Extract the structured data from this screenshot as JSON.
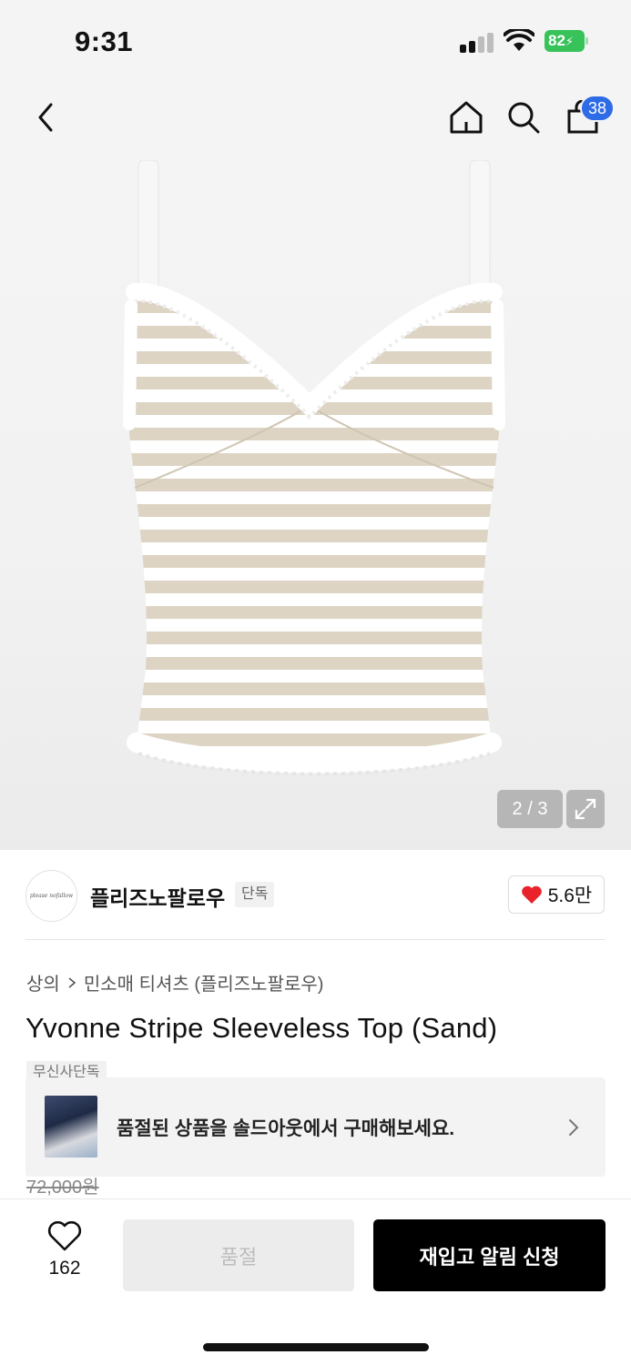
{
  "status_bar": {
    "time": "9:31",
    "battery": "82"
  },
  "nav": {
    "back_icon": "chevron-left-icon",
    "home_icon": "home-icon",
    "search_icon": "search-icon",
    "cart_icon": "shopping-bag-icon",
    "cart_count": "38"
  },
  "gallery": {
    "counter": "2 / 3",
    "expand_icon": "expand-icon"
  },
  "brand": {
    "logo_text": "please nofallow",
    "name": "플리즈노팔로우",
    "tag": "단독",
    "like_count": "5.6만",
    "like_icon": "heart-filled-icon",
    "like_color": "#e8232a"
  },
  "breadcrumb": {
    "category": "상의",
    "subcategory": "민소매 티셔츠 (플리즈노팔로우)"
  },
  "product": {
    "title": "Yvonne Stripe Sleeveless Top (Sand)",
    "exclusive_tag": "무신사단독",
    "original_price": "72,000원"
  },
  "soldout_banner": {
    "text": "품절된 상품을 솔드아웃에서 구매해보세요."
  },
  "bottom_bar": {
    "wish_count": "162",
    "soldout_label": "품절",
    "restock_label": "재입고 알림 신청"
  }
}
